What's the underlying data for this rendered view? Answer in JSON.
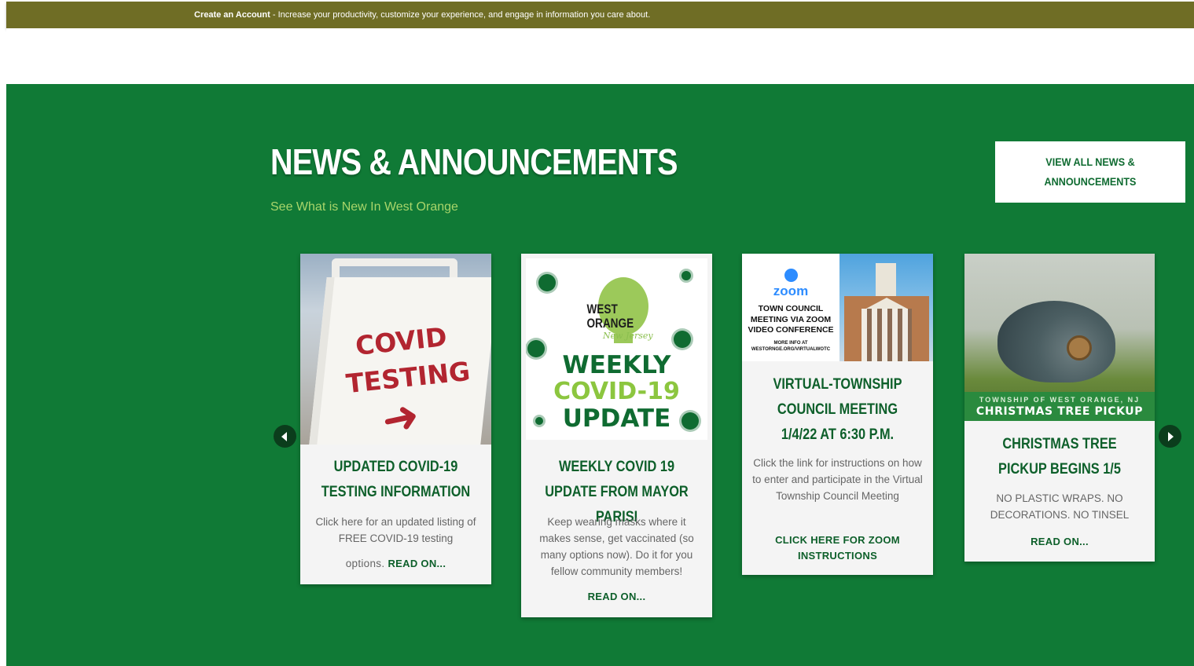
{
  "topbar": {
    "link_label": "Create an Account",
    "message": " - Increase your productivity, customize your experience, and engage in information you care about."
  },
  "news": {
    "title": "NEWS & ANNOUNCEMENTS",
    "subtitle": "See What is New In West Orange",
    "view_all_label": "VIEW ALL NEWS & ANNOUNCEMENTS",
    "prev_icon": "chevron-left-icon",
    "next_icon": "chevron-right-icon",
    "colors": {
      "section_bg": "#107a36",
      "topbar_bg": "#6f6d25",
      "accent_text": "#a8d56a",
      "heading_green": "#0d5f2a"
    }
  },
  "cards": [
    {
      "title": "UPDATED COVID-19 TESTING INFORMATION",
      "body": "Click here for an updated listing of FREE COVID-19 testing",
      "body_tail": "options.",
      "read_label": "READ ON...",
      "image_text": [
        "COVID",
        "TESTING"
      ]
    },
    {
      "title": "WEEKLY COVID 19 UPDATE FROM MAYOR PARISI",
      "body": "Keep wearing masks where it makes sense, get vaccinated (so many options now). Do it for you fellow community members!",
      "read_label": "READ ON...",
      "image_text": {
        "brand_line1": "WEST",
        "brand_line2": "ORANGE",
        "brand_script": "New Jersey",
        "line1": "WEEKLY",
        "line2": "COVID-19",
        "line3": "UPDATE"
      }
    },
    {
      "title": "VIRTUAL-TOWNSHIP COUNCIL MEETING 1/4/22 AT 6:30 P.M.",
      "body": "Click the link for instructions on how to enter and participate in the Virtual Township Council Meeting",
      "read_label": "CLICK HERE FOR ZOOM INSTRUCTIONS",
      "image_text": {
        "zoom": "zoom",
        "caption": "TOWN COUNCIL MEETING VIA ZOOM VIDEO CONFERENCE",
        "small": "MORE INFO AT WESTORNGE.ORG/VIRTUALWOTC"
      }
    },
    {
      "title": "CHRISTMAS TREE PICKUP BEGINS 1/5",
      "body": "NO PLASTIC WRAPS. NO DECORATIONS. NO TINSEL",
      "read_label": "READ ON...",
      "image_text": {
        "banner_small": "TOWNSHIP OF WEST ORANGE, NJ",
        "banner_big": "CHRISTMAS TREE PICKUP"
      }
    }
  ]
}
